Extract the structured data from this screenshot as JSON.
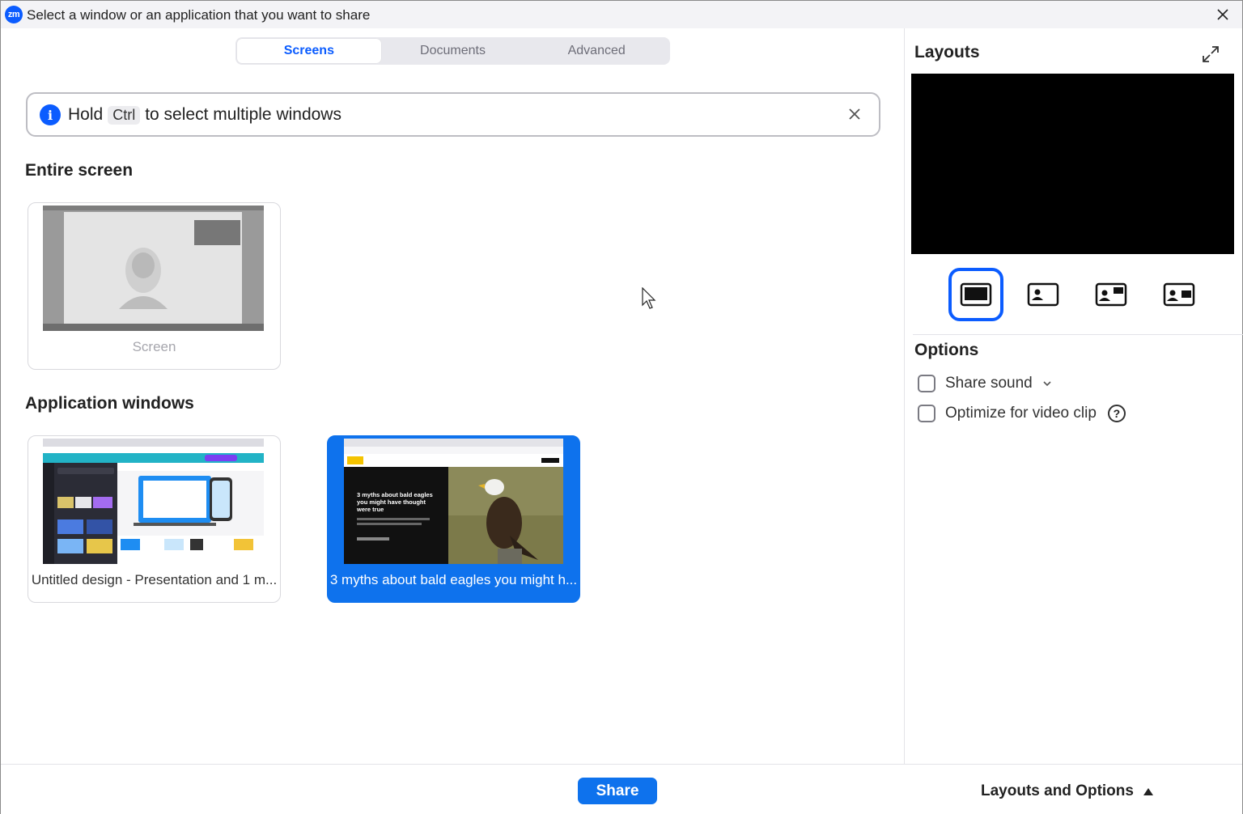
{
  "window": {
    "title": "Select a window or an application that you want to share",
    "logo_text": "zm"
  },
  "tabs": [
    {
      "label": "Screens",
      "active": true
    },
    {
      "label": "Documents",
      "active": false
    },
    {
      "label": "Advanced",
      "active": false
    }
  ],
  "info_banner": {
    "text_before": "Hold",
    "key": "Ctrl",
    "text_after": "to select multiple windows"
  },
  "entire_screen": {
    "heading": "Entire screen",
    "items": [
      {
        "label": "Screen"
      }
    ]
  },
  "application_windows": {
    "heading": "Application windows",
    "items": [
      {
        "label": "Untitled design - Presentation and 1 m...",
        "selected": false
      },
      {
        "label": "3 myths about bald eagles you might h...",
        "selected": true,
        "headline": "3 myths about bald eagles you might have thought were true"
      }
    ]
  },
  "layouts_panel": {
    "title": "Layouts",
    "layout_options": [
      "full-screen",
      "picture-in-picture-left",
      "picture-in-picture-top-right",
      "side-by-side-right"
    ],
    "selected_layout": "full-screen"
  },
  "options_panel": {
    "title": "Options",
    "items": [
      {
        "label": "Share sound",
        "checked": false
      },
      {
        "label": "Optimize for video clip",
        "checked": false
      }
    ]
  },
  "bottom_bar": {
    "share_label": "Share",
    "layouts_toggle_label": "Layouts and Options"
  },
  "colors": {
    "accent": "#0b5cff",
    "selected_card": "#0e72ed"
  }
}
